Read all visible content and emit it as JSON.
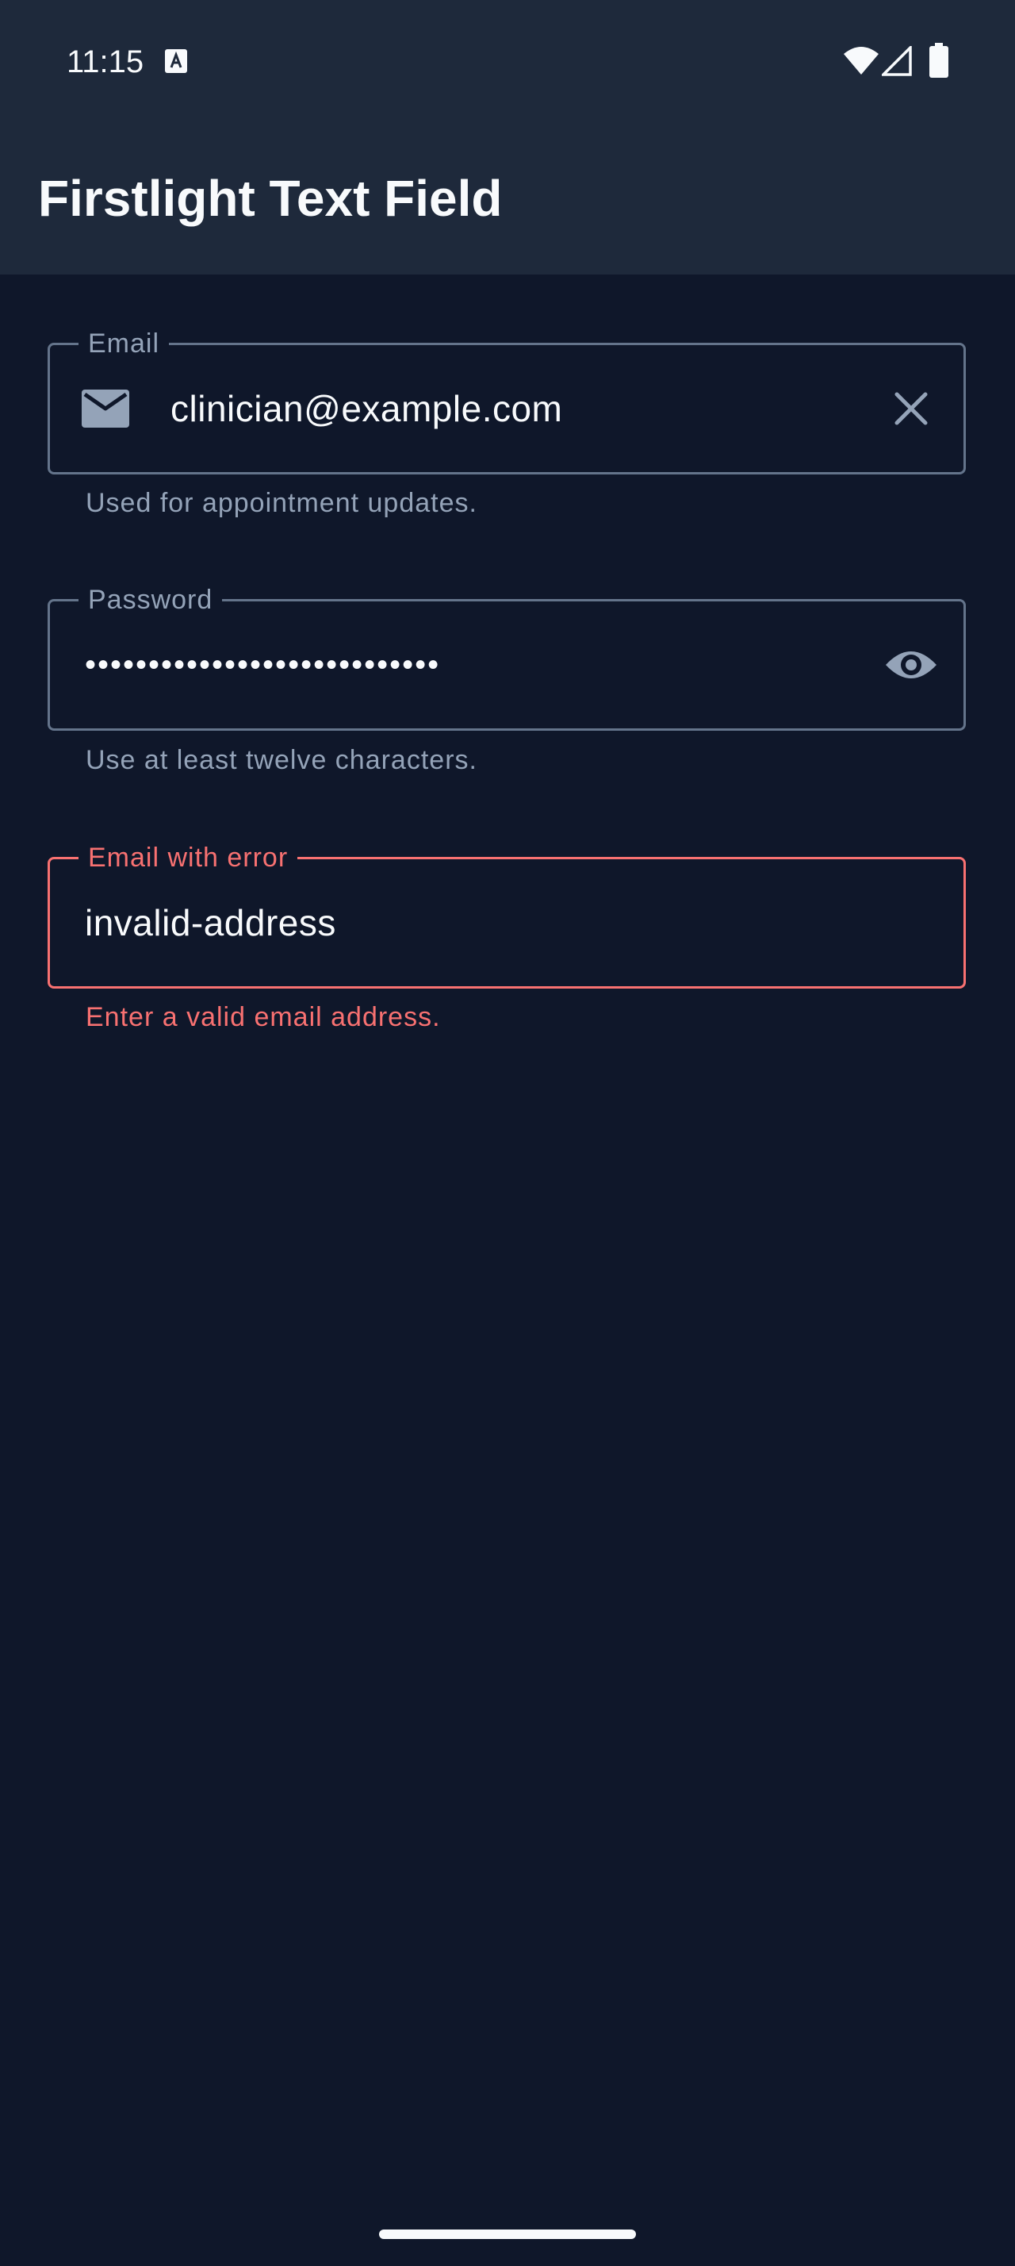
{
  "status_bar": {
    "time": "11:15",
    "icons": [
      "a-icon",
      "wifi-icon",
      "signal-icon",
      "battery-icon"
    ]
  },
  "app_bar": {
    "title": "Firstlight Text Field"
  },
  "fields": {
    "email": {
      "label": "Email",
      "value": "clinician@example.com",
      "helper": "Used for appointment updates.",
      "leading_icon": "mail-icon",
      "trailing_icon": "close-icon"
    },
    "password": {
      "label": "Password",
      "value": "••••••••••••••••••••••••••••",
      "helper": "Use at least twelve characters.",
      "trailing_icon": "eye-icon"
    },
    "email_error": {
      "label": "Email with error",
      "value": "invalid-address",
      "helper": "Enter a valid email address."
    }
  },
  "colors": {
    "background": "#0f172a",
    "app_bar": "#1e293b",
    "outline": "#64748b",
    "label": "#94a3b8",
    "text": "#f8fafc",
    "error": "#f87171"
  }
}
